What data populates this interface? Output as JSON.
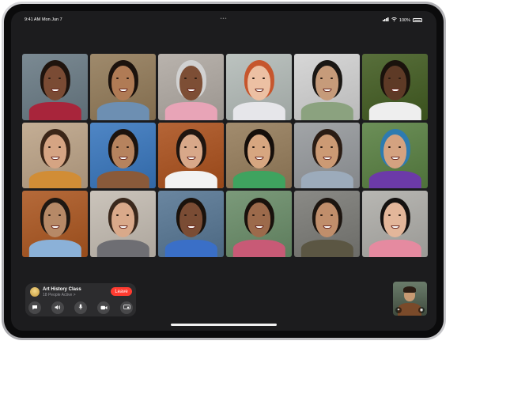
{
  "status_bar": {
    "time": "9:41 AM",
    "date": "Mon Jun 7",
    "dots": "•••",
    "battery": "100%"
  },
  "call": {
    "title": "Art History Class",
    "subtitle": "18 People Active >",
    "leave_label": "Leave",
    "controls": [
      "message-icon",
      "speaker-icon",
      "microphone-icon",
      "camera-icon",
      "shareplay-icon"
    ]
  },
  "participants": [
    {
      "bg": "#7b8a93",
      "skin": "#7a4b34",
      "hair": "#1e130d",
      "shirt": "#a8253b"
    },
    {
      "bg": "#9f8a6c",
      "skin": "#b07b55",
      "hair": "#1b120d",
      "shirt": "#6d8fb2"
    },
    {
      "bg": "#b9b3ad",
      "skin": "#7d4e35",
      "hair": "#d1d1d1",
      "shirt": "#e8a4b7"
    },
    {
      "bg": "#bcc3c0",
      "skin": "#ecc0a3",
      "hair": "#c6562d",
      "shirt": "#e6e6ea"
    },
    {
      "bg": "#d7d7d7",
      "skin": "#c69b7a",
      "hair": "#1a1714",
      "shirt": "#8ba27f"
    },
    {
      "bg": "#586f3b",
      "skin": "#5e3a26",
      "hair": "#1a120c",
      "shirt": "#eeeeee"
    },
    {
      "bg": "#c4ae95",
      "skin": "#d5a483",
      "hair": "#3b2618",
      "shirt": "#d18d36"
    },
    {
      "bg": "#4f86c5",
      "skin": "#b6835e",
      "hair": "#1c130e",
      "shirt": "#8a5a3a"
    },
    {
      "bg": "#b56537",
      "skin": "#d8a889",
      "hair": "#1f1510",
      "shirt": "#f2f2f2"
    },
    {
      "bg": "#a28c6e",
      "skin": "#d7a680",
      "hair": "#150e0a",
      "shirt": "#3fa35f"
    },
    {
      "bg": "#a2a5a8",
      "skin": "#cc9a74",
      "hair": "#2a1c14",
      "shirt": "#9cabbb"
    },
    {
      "bg": "#6c8f58",
      "skin": "#d4a280",
      "hair": "#2e7bb0",
      "shirt": "#6c3aa8"
    },
    {
      "bg": "#b56a3a",
      "skin": "#b68967",
      "hair": "#1e1712",
      "shirt": "#8bb1d8"
    },
    {
      "bg": "#cbc4bb",
      "skin": "#d9a98a",
      "hair": "#3a281c",
      "shirt": "#6e6e73"
    },
    {
      "bg": "#6a86a0",
      "skin": "#7a4c34",
      "hair": "#1a120c",
      "shirt": "#3a6fc7"
    },
    {
      "bg": "#7b9a7a",
      "skin": "#9c6a4b",
      "hair": "#18110c",
      "shirt": "#c85a76"
    },
    {
      "bg": "#8a8a86",
      "skin": "#c08e6b",
      "hair": "#1c1510",
      "shirt": "#5b5643"
    },
    {
      "bg": "#b8b7b3",
      "skin": "#e3b69a",
      "hair": "#141110",
      "shirt": "#e58aa0"
    }
  ],
  "active_index": 8
}
